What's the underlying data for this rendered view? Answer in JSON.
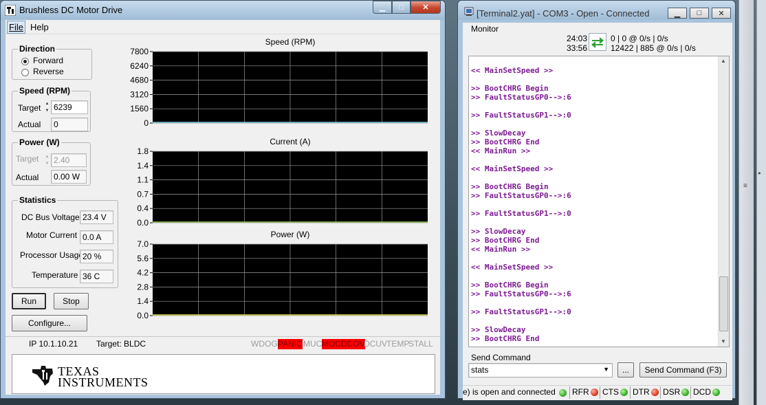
{
  "left_window": {
    "title": "Brushless DC Motor Drive",
    "menu": [
      "File",
      "Help"
    ],
    "direction": {
      "title": "Direction",
      "options": [
        "Forward",
        "Reverse"
      ],
      "selected": "Forward"
    },
    "speed": {
      "title": "Speed (RPM)",
      "target_label": "Target",
      "target_value": "6239",
      "actual_label": "Actual",
      "actual_value": "0"
    },
    "power": {
      "title": "Power (W)",
      "target_label": "Target",
      "target_value": "2.40",
      "actual_label": "Actual",
      "actual_value": "0.00 W"
    },
    "statistics": {
      "title": "Statistics",
      "rows": [
        {
          "label": "DC Bus Voltage",
          "value": "23.4 V"
        },
        {
          "label": "Motor Current",
          "value": "0.0 A"
        },
        {
          "label": "Processor Usage",
          "value": "20 %"
        },
        {
          "label": "Temperature",
          "value": "36 C"
        }
      ]
    },
    "buttons": {
      "run": "Run",
      "stop": "Stop",
      "configure": "Configure..."
    },
    "status": {
      "ip": "IP 10.1.10.21",
      "target": "Target: BLDC",
      "flags": [
        {
          "text": "WDOG",
          "active": false
        },
        {
          "text": "PANIC",
          "active": true
        },
        {
          "text": "MUC",
          "active": false
        },
        {
          "text": "MOC",
          "active": true
        },
        {
          "text": "DCOV",
          "active": true
        },
        {
          "text": "DCUV",
          "active": false
        },
        {
          "text": "TEMP",
          "active": false
        },
        {
          "text": "STALL",
          "active": false
        }
      ]
    },
    "logo": {
      "line1": "Texas",
      "line2": "Instruments"
    }
  },
  "chart_data": [
    {
      "type": "line",
      "title": "Speed (RPM)",
      "yticks": [
        "7800",
        "6240",
        "4680",
        "3120",
        "1560",
        "0"
      ],
      "ylim": [
        0,
        7800
      ],
      "trace_color": "#7fd0e0",
      "values": [
        0,
        0
      ]
    },
    {
      "type": "line",
      "title": "Current (A)",
      "yticks": [
        "1.8",
        "1.4",
        "1.1",
        "0.7",
        "0.4",
        "0.0"
      ],
      "ylim": [
        0,
        1.8
      ],
      "trace_color": "#9ccf60",
      "values": [
        0,
        0
      ]
    },
    {
      "type": "line",
      "title": "Power (W)",
      "yticks": [
        "7.0",
        "5.6",
        "4.2",
        "2.8",
        "1.4",
        "0.0"
      ],
      "ylim": [
        0,
        7.0
      ],
      "trace_color": "#e0e060",
      "values": [
        0,
        0
      ]
    }
  ],
  "right_window": {
    "title": "[Terminal2.yat] - COM3 - Open - Connected",
    "monitor_label": "Monitor",
    "counters": {
      "time1": "24:03",
      "time2": "33:56",
      "line1": "0 | 0 @ 0/s | 0/s",
      "line2": "12422 | 885 @ 0/s | 0/s"
    },
    "terminal_lines": [
      "<< MainSetSpeed >>",
      "",
      ">> BootCHRG Begin",
      ">> FaultStatusGP0-->:6",
      "",
      ">> FaultStatusGP1-->:0",
      "",
      ">> SlowDecay",
      ">> BootCHRG End",
      "<< MainRun >>",
      "",
      "<< MainSetSpeed >>",
      "",
      ">> BootCHRG Begin",
      ">> FaultStatusGP0-->:6",
      "",
      ">> FaultStatusGP1-->:0",
      "",
      ">> SlowDecay",
      ">> BootCHRG End",
      "<< MainRun >>",
      "",
      "<< MainSetSpeed >>",
      "",
      ">> BootCHRG Begin",
      ">> FaultStatusGP0-->:6",
      "",
      ">> FaultStatusGP1-->:0",
      "",
      ">> SlowDecay",
      ">> BootCHRG End"
    ],
    "send_command": {
      "label": "Send Command",
      "value": "stats",
      "dots_button": "...",
      "send_button": "Send Command (F3)"
    },
    "status": {
      "text": "e) is open and connected",
      "signals": [
        {
          "name": "RFR",
          "state": "red"
        },
        {
          "name": "CTS",
          "state": "green"
        },
        {
          "name": "DTR",
          "state": "red"
        },
        {
          "name": "DSR",
          "state": "green"
        },
        {
          "name": "DCD",
          "state": "green"
        }
      ]
    }
  },
  "colors": {
    "alarm_red": "#ff0000",
    "terminal_text": "#7c1a92",
    "chart_bg": "#000000",
    "chart_grid": "#9a9a9a"
  }
}
